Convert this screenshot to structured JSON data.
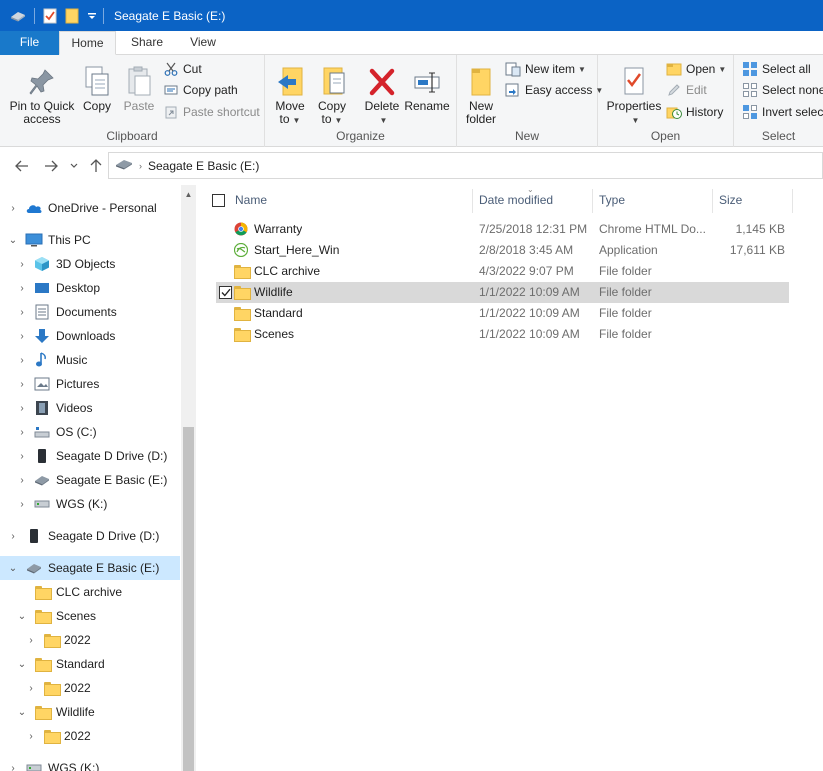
{
  "window": {
    "title": "Seagate E Basic (E:)"
  },
  "ribbon_tabs": [
    "File",
    "Home",
    "Share",
    "View"
  ],
  "ribbon": {
    "clipboard": {
      "label": "Clipboard",
      "pin": "Pin to Quick access",
      "pin_l1": "Pin to Quick",
      "pin_l2": "access",
      "copy": "Copy",
      "paste": "Paste",
      "cut": "Cut",
      "copy_path": "Copy path",
      "paste_shortcut": "Paste shortcut"
    },
    "organize": {
      "label": "Organize",
      "move_l1": "Move",
      "move_l2": "to",
      "copy_l1": "Copy",
      "copy_l2": "to",
      "delete": "Delete",
      "rename": "Rename"
    },
    "new": {
      "label": "New",
      "new_folder_l1": "New",
      "new_folder_l2": "folder",
      "new_item": "New item",
      "easy_access": "Easy access"
    },
    "open": {
      "label": "Open",
      "properties": "Properties",
      "open": "Open",
      "edit": "Edit",
      "history": "History"
    },
    "select": {
      "label": "Select",
      "select_all": "Select all",
      "select_none": "Select none",
      "invert": "Invert select"
    }
  },
  "address": {
    "path": "Seagate E Basic (E:)"
  },
  "nav": [
    {
      "label": "OneDrive - Personal"
    },
    {
      "label": "This PC"
    },
    {
      "label": "3D Objects"
    },
    {
      "label": "Desktop"
    },
    {
      "label": "Documents"
    },
    {
      "label": "Downloads"
    },
    {
      "label": "Music"
    },
    {
      "label": "Pictures"
    },
    {
      "label": "Videos"
    },
    {
      "label": "OS (C:)"
    },
    {
      "label": "Seagate D Drive (D:)"
    },
    {
      "label": "Seagate E Basic (E:)"
    },
    {
      "label": "WGS (K:)"
    },
    {
      "label": "Seagate D Drive (D:)"
    },
    {
      "label": "Seagate E Basic (E:)"
    },
    {
      "label": "CLC archive"
    },
    {
      "label": "Scenes"
    },
    {
      "label": "2022"
    },
    {
      "label": "Standard"
    },
    {
      "label": "2022"
    },
    {
      "label": "Wildlife"
    },
    {
      "label": "2022"
    },
    {
      "label": "WGS (K:)"
    }
  ],
  "columns": {
    "name": "Name",
    "date": "Date modified",
    "type": "Type",
    "size": "Size"
  },
  "files": [
    {
      "name": "Warranty",
      "date": "7/25/2018 12:31 PM",
      "type": "Chrome HTML Do...",
      "size": "1,145 KB",
      "icon": "chrome-icon"
    },
    {
      "name": "Start_Here_Win",
      "date": "2/8/2018 3:45 AM",
      "type": "Application",
      "size": "17,611 KB",
      "icon": "seagate-app-icon"
    },
    {
      "name": "CLC archive",
      "date": "4/3/2022 9:07 PM",
      "type": "File folder",
      "size": "",
      "icon": "folder-icon"
    },
    {
      "name": "Wildlife",
      "date": "1/1/2022 10:09 AM",
      "type": "File folder",
      "size": "",
      "icon": "folder-icon"
    },
    {
      "name": "Standard",
      "date": "1/1/2022 10:09 AM",
      "type": "File folder",
      "size": "",
      "icon": "folder-icon"
    },
    {
      "name": "Scenes",
      "date": "1/1/2022 10:09 AM",
      "type": "File folder",
      "size": "",
      "icon": "folder-icon"
    }
  ],
  "colors": {
    "titlebar": "#0b63c5",
    "file_tab": "#1979ca",
    "selection": "#cce8ff"
  }
}
